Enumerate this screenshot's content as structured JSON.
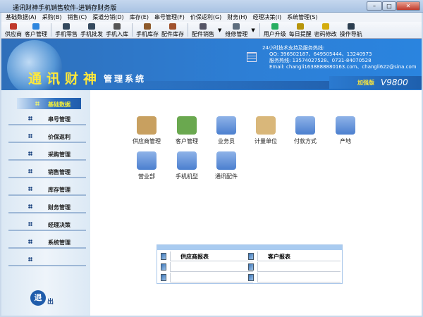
{
  "window": {
    "title": "通讯财神手机销售软件-进销存财务版"
  },
  "menu": [
    "基础数据(A)",
    "采购(B)",
    "销售(C)",
    "渠道分销(D)",
    "库存(E)",
    "串号管理(F)",
    "价保返利(G)",
    "财务(H)",
    "经理决策(I)",
    "系统管理(S)"
  ],
  "toolbar": [
    {
      "label": "供应商",
      "icon": "supplier-icon",
      "color": "#c0392b"
    },
    {
      "label": "客户管理",
      "icon": "customer-icon",
      "color": "#2e86de"
    },
    {
      "label": "手机零售",
      "icon": "phone-retail-icon",
      "color": "#34495e"
    },
    {
      "label": "手机批发",
      "icon": "phone-wholesale-icon",
      "color": "#34495e"
    },
    {
      "label": "手机入库",
      "icon": "phone-stockin-icon",
      "color": "#555"
    },
    {
      "label": "手机库存",
      "icon": "phone-stock-icon",
      "color": "#8e5a2b"
    },
    {
      "label": "配件库存",
      "icon": "parts-stock-icon",
      "color": "#a0522d"
    },
    {
      "label": "配件销售",
      "icon": "parts-sales-icon",
      "color": "#556"
    },
    {
      "label": "维修管理",
      "icon": "repair-icon",
      "color": "#5d6d7e"
    },
    {
      "label": "用户升级",
      "icon": "upgrade-icon",
      "color": "#27ae60"
    },
    {
      "label": "每日提醒",
      "icon": "reminder-icon",
      "color": "#b7950b"
    },
    {
      "label": "密码修改",
      "icon": "lock-icon",
      "color": "#d4ac0d"
    },
    {
      "label": "操作导航",
      "icon": "navigation-icon",
      "color": "#2c3e50"
    }
  ],
  "banner": {
    "brand": "通讯财神",
    "subtitle": "管理系统",
    "support_title": "24小时技术支持及服务热线:",
    "qq": "QQ: 396502187、649505444、13240973",
    "hotline": "服务热线: 13574027528、0731-84070528",
    "email": "Email: changli1638888880163.com、changli622@sina.com",
    "edition": "加强版",
    "version": "V9800"
  },
  "sidebar": {
    "items": [
      "基础数据",
      "串号管理",
      "价保返利",
      "采购管理",
      "销售管理",
      "库存管理",
      "财务管理",
      "经理决策",
      "系统管理",
      ""
    ],
    "active": 0,
    "exit_a": "退",
    "exit_b": "出"
  },
  "modules": [
    {
      "label": "供应商管理",
      "icon": "supplier-book-icon"
    },
    {
      "label": "客户管理",
      "icon": "customers-icon"
    },
    {
      "label": "业务员",
      "icon": "salesman-folder-icon"
    },
    {
      "label": "计量单位",
      "icon": "clipboard-icon"
    },
    {
      "label": "付款方式",
      "icon": "payment-folder-icon"
    },
    {
      "label": "产地",
      "icon": "origin-folder-icon"
    },
    {
      "label": "营业部",
      "icon": "box-folder-icon"
    },
    {
      "label": "手机机型",
      "icon": "phone-model-folder-icon"
    },
    {
      "label": "通讯配件",
      "icon": "film-folder-icon"
    }
  ],
  "reports": {
    "left": [
      "供应商报表",
      "",
      ""
    ],
    "right": [
      "客户报表",
      "",
      ""
    ]
  }
}
